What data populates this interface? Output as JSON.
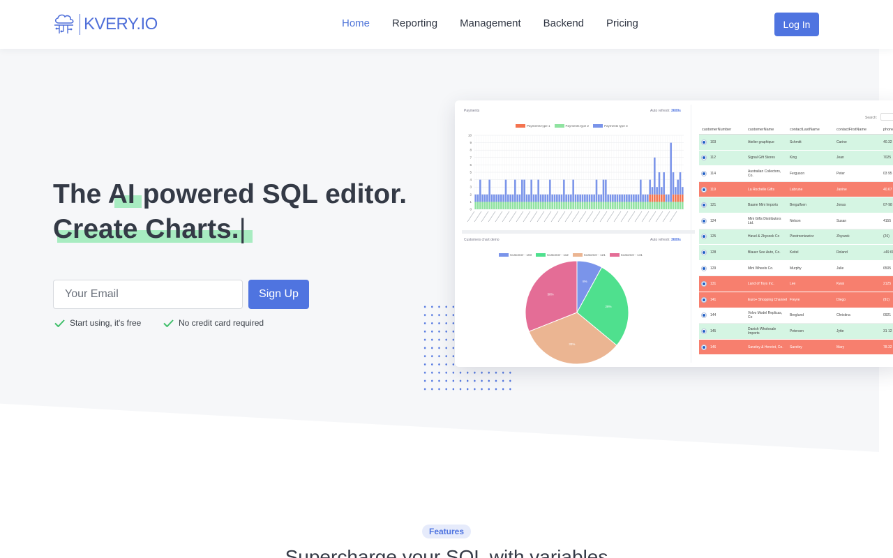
{
  "nav": {
    "logo_text": "KVERY.IO",
    "items": [
      {
        "label": "Home",
        "active": true
      },
      {
        "label": "Reporting",
        "active": false
      },
      {
        "label": "Management",
        "active": false
      },
      {
        "label": "Backend",
        "active": false
      },
      {
        "label": "Pricing",
        "active": false
      }
    ],
    "login_label": "Log In"
  },
  "hero": {
    "line1_pre": "The ",
    "line1_hl": "AI",
    "line1_post": " powered SQL editor.",
    "line2_hl": "Create Charts.",
    "line2_cursor": "|",
    "email_placeholder": "Your Email",
    "signup_label": "Sign Up",
    "perks": [
      "Start using, it's free",
      "No credit card required"
    ],
    "accent_color": "#4f74e0",
    "highlight_color": "#a8ecc1"
  },
  "dashboard": {
    "bar_panel": {
      "title": "Payments",
      "refresh_label": "Auto refresh:",
      "refresh_value": "3600s",
      "legend": [
        {
          "name": "Payments type 1",
          "color": "#f4734f"
        },
        {
          "name": "Payments type 2",
          "color": "#8fe3a0"
        },
        {
          "name": "Payments type 3",
          "color": "#7a94ea"
        }
      ],
      "y_ticks": [
        "10",
        "9",
        "8",
        "7",
        "6",
        "5",
        "4",
        "3",
        "2",
        "1",
        "0"
      ]
    },
    "pie_panel": {
      "title": "Customers chart demo",
      "refresh_label": "Auto refresh:",
      "refresh_value": "3600s",
      "legend": [
        {
          "name": "Customer - 103",
          "color": "#7a94ea"
        },
        {
          "name": "Customer - 112",
          "color": "#4fe08e"
        },
        {
          "name": "Customer - 121",
          "color": "#ebb592"
        },
        {
          "name": "Customer - 141",
          "color": "#e46d96"
        }
      ],
      "slices": [
        {
          "label": "8%",
          "value": 8,
          "color": "#7a94ea"
        },
        {
          "label": "28%",
          "value": 28,
          "color": "#4fe08e"
        },
        {
          "label": "33%",
          "value": 33,
          "color": "#ebb592"
        },
        {
          "label": "30%",
          "value": 31,
          "color": "#e46d96"
        }
      ]
    },
    "table": {
      "search_label": "Search:",
      "columns": [
        "customerNumber",
        "customerName",
        "contactLastName",
        "contactFirstName",
        "phone"
      ],
      "rows": [
        {
          "style": "green",
          "num": "103",
          "name": "Atelier graphique",
          "last": "Schmitt",
          "first": "Carine",
          "phone": "40.32"
        },
        {
          "style": "green",
          "num": "112",
          "name": "Signal Gift Stores",
          "last": "King",
          "first": "Jean",
          "phone": "7025"
        },
        {
          "style": "white",
          "num": "114",
          "name": "Australian Collectors, Co.",
          "last": "Ferguson",
          "first": "Peter",
          "phone": "03 95"
        },
        {
          "style": "red",
          "num": "119",
          "name": "La Rochelle Gifts",
          "last": "Labrune",
          "first": "Janine",
          "phone": "40.67"
        },
        {
          "style": "green",
          "num": "121",
          "name": "Baane Mini Imports",
          "last": "Bergulfsen",
          "first": "Jonas",
          "phone": "07-98"
        },
        {
          "style": "white",
          "num": "124",
          "name": "Mini Gifts Distributors Ltd.",
          "last": "Nelson",
          "first": "Susan",
          "phone": "4155"
        },
        {
          "style": "green",
          "num": "125",
          "name": "Havel & Zbyszek Co",
          "last": "Piestrzeniewicz",
          "first": "Zbyszek",
          "phone": "(26)"
        },
        {
          "style": "green",
          "num": "128",
          "name": "Blauer See Auto, Co.",
          "last": "Keitel",
          "first": "Roland",
          "phone": "+49 69"
        },
        {
          "style": "white",
          "num": "129",
          "name": "Mini Wheels Co.",
          "last": "Murphy",
          "first": "Julie",
          "phone": "6505"
        },
        {
          "style": "red",
          "num": "131",
          "name": "Land of Toys Inc.",
          "last": "Lee",
          "first": "Kwai",
          "phone": "2125"
        },
        {
          "style": "red",
          "num": "141",
          "name": "Euro+ Shopping Channel",
          "last": "Freyre",
          "first": "Diego",
          "phone": "(91)"
        },
        {
          "style": "white",
          "num": "144",
          "name": "Volvo Model Replicas, Co",
          "last": "Berglund",
          "first": "Christina",
          "phone": "0921"
        },
        {
          "style": "green",
          "num": "145",
          "name": "Danish Wholesale Imports",
          "last": "Petersen",
          "first": "Jytte",
          "phone": "31 12"
        },
        {
          "style": "red",
          "num": "146",
          "name": "Saveley & Henriot, Co.",
          "last": "Saveley",
          "first": "Mary",
          "phone": "78.32"
        }
      ]
    }
  },
  "features": {
    "badge": "Features",
    "title": "Supercharge your SQL with variables"
  }
}
